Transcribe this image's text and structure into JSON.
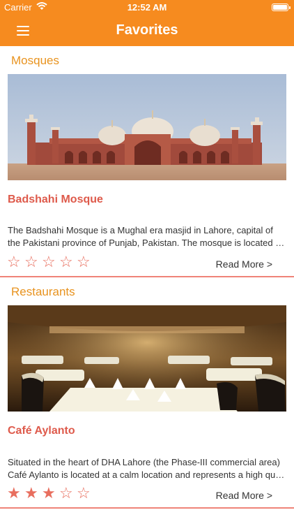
{
  "status_bar": {
    "carrier": "Carrier",
    "time": "12:52 AM",
    "wifi_icon": "wifi-icon",
    "battery_icon": "battery-icon"
  },
  "nav": {
    "title": "Favorites",
    "menu_icon": "hamburger-menu-icon"
  },
  "sections": [
    {
      "header": "Mosques",
      "item": {
        "title": "Badshahi Mosque",
        "desc_line1": "The Badshahi Mosque is a Mughal era masjid in Lahore, capital of",
        "desc_line2": "the Pakistani province of Punjab, Pakistan. The mosque is located outside the walls",
        "rating": 0,
        "read_more": "Read More >"
      }
    },
    {
      "header": "Restaurants",
      "item": {
        "title": "Café Aylanto",
        "desc_line1": "Situated in the heart of DHA Lahore (the Phase-III commercial area)",
        "desc_line2": "Café Aylanto is located at a calm location and represents a high quality dining experience",
        "rating": 3,
        "read_more": "Read More >"
      }
    }
  ],
  "colors": {
    "accent": "#f68b1f",
    "section_header": "#e8931f",
    "title": "#de5a4b",
    "star": "#e86e5e",
    "divider": "#ef8378"
  }
}
